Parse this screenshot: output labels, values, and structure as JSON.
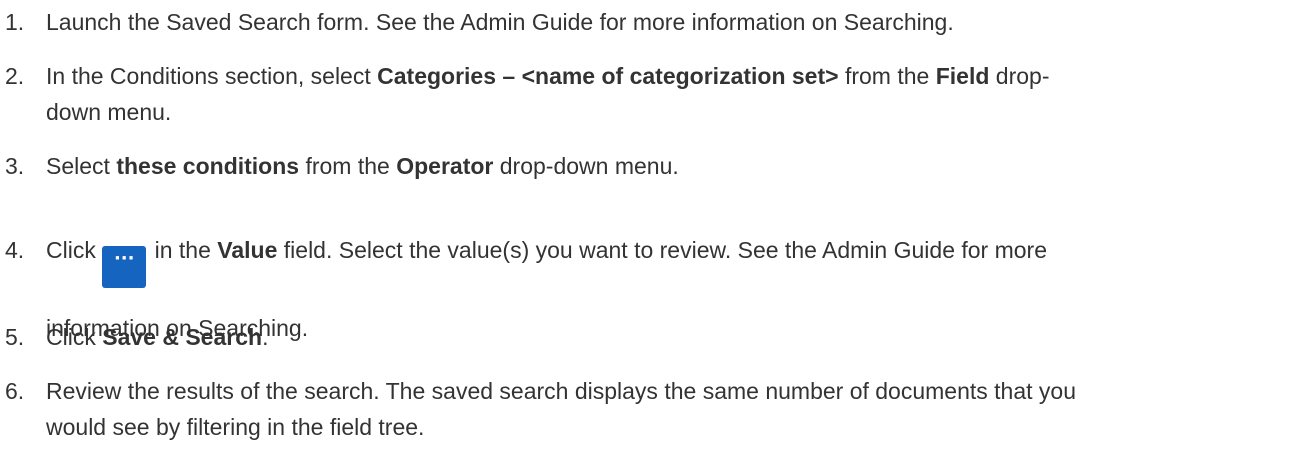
{
  "steps": [
    {
      "number": "1.",
      "text": "Launch the Saved Search form. See the Admin Guide for more information on Searching."
    },
    {
      "number": "2.",
      "pre": "In the Conditions section, select ",
      "bold1": "Categories – <name of categorization set>",
      "mid": " from the ",
      "bold2": "Field",
      "post1": " drop-",
      "post2": "down menu."
    },
    {
      "number": "3.",
      "pre": "Select ",
      "bold1": "these conditions",
      "mid": " from the ",
      "bold2": "Operator",
      "post": " drop-down menu."
    },
    {
      "number": "4.",
      "pre": "Click",
      "button_glyph": "···",
      "mid": " in the ",
      "bold": "Value",
      "post1": " field. Select the value(s) you want to review. See the Admin Guide for more",
      "post2": "information on Searching."
    },
    {
      "number": "5.",
      "pre": "Click ",
      "bold": "Save & Search",
      "post": "."
    },
    {
      "number": "6.",
      "line1": "Review the results of the search. The saved search displays the same number of documents that you",
      "line2": "would see by filtering in the field tree."
    }
  ]
}
